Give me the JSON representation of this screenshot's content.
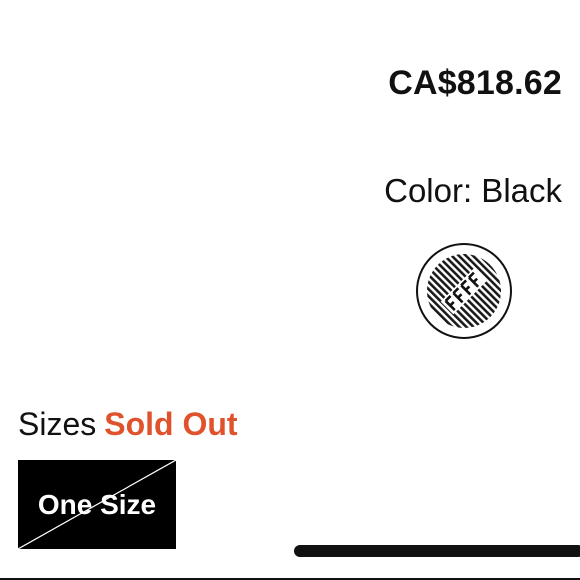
{
  "product": {
    "price": "CA$818.62",
    "color_label": "Color: Black"
  },
  "swatch": {
    "icon": "striped-ff-monogram-swatch",
    "selected": true
  },
  "sizes": {
    "label": "Sizes",
    "status": "Sold Out",
    "status_color": "#e0522b",
    "options": [
      {
        "label": "One Size",
        "available": false
      }
    ]
  }
}
